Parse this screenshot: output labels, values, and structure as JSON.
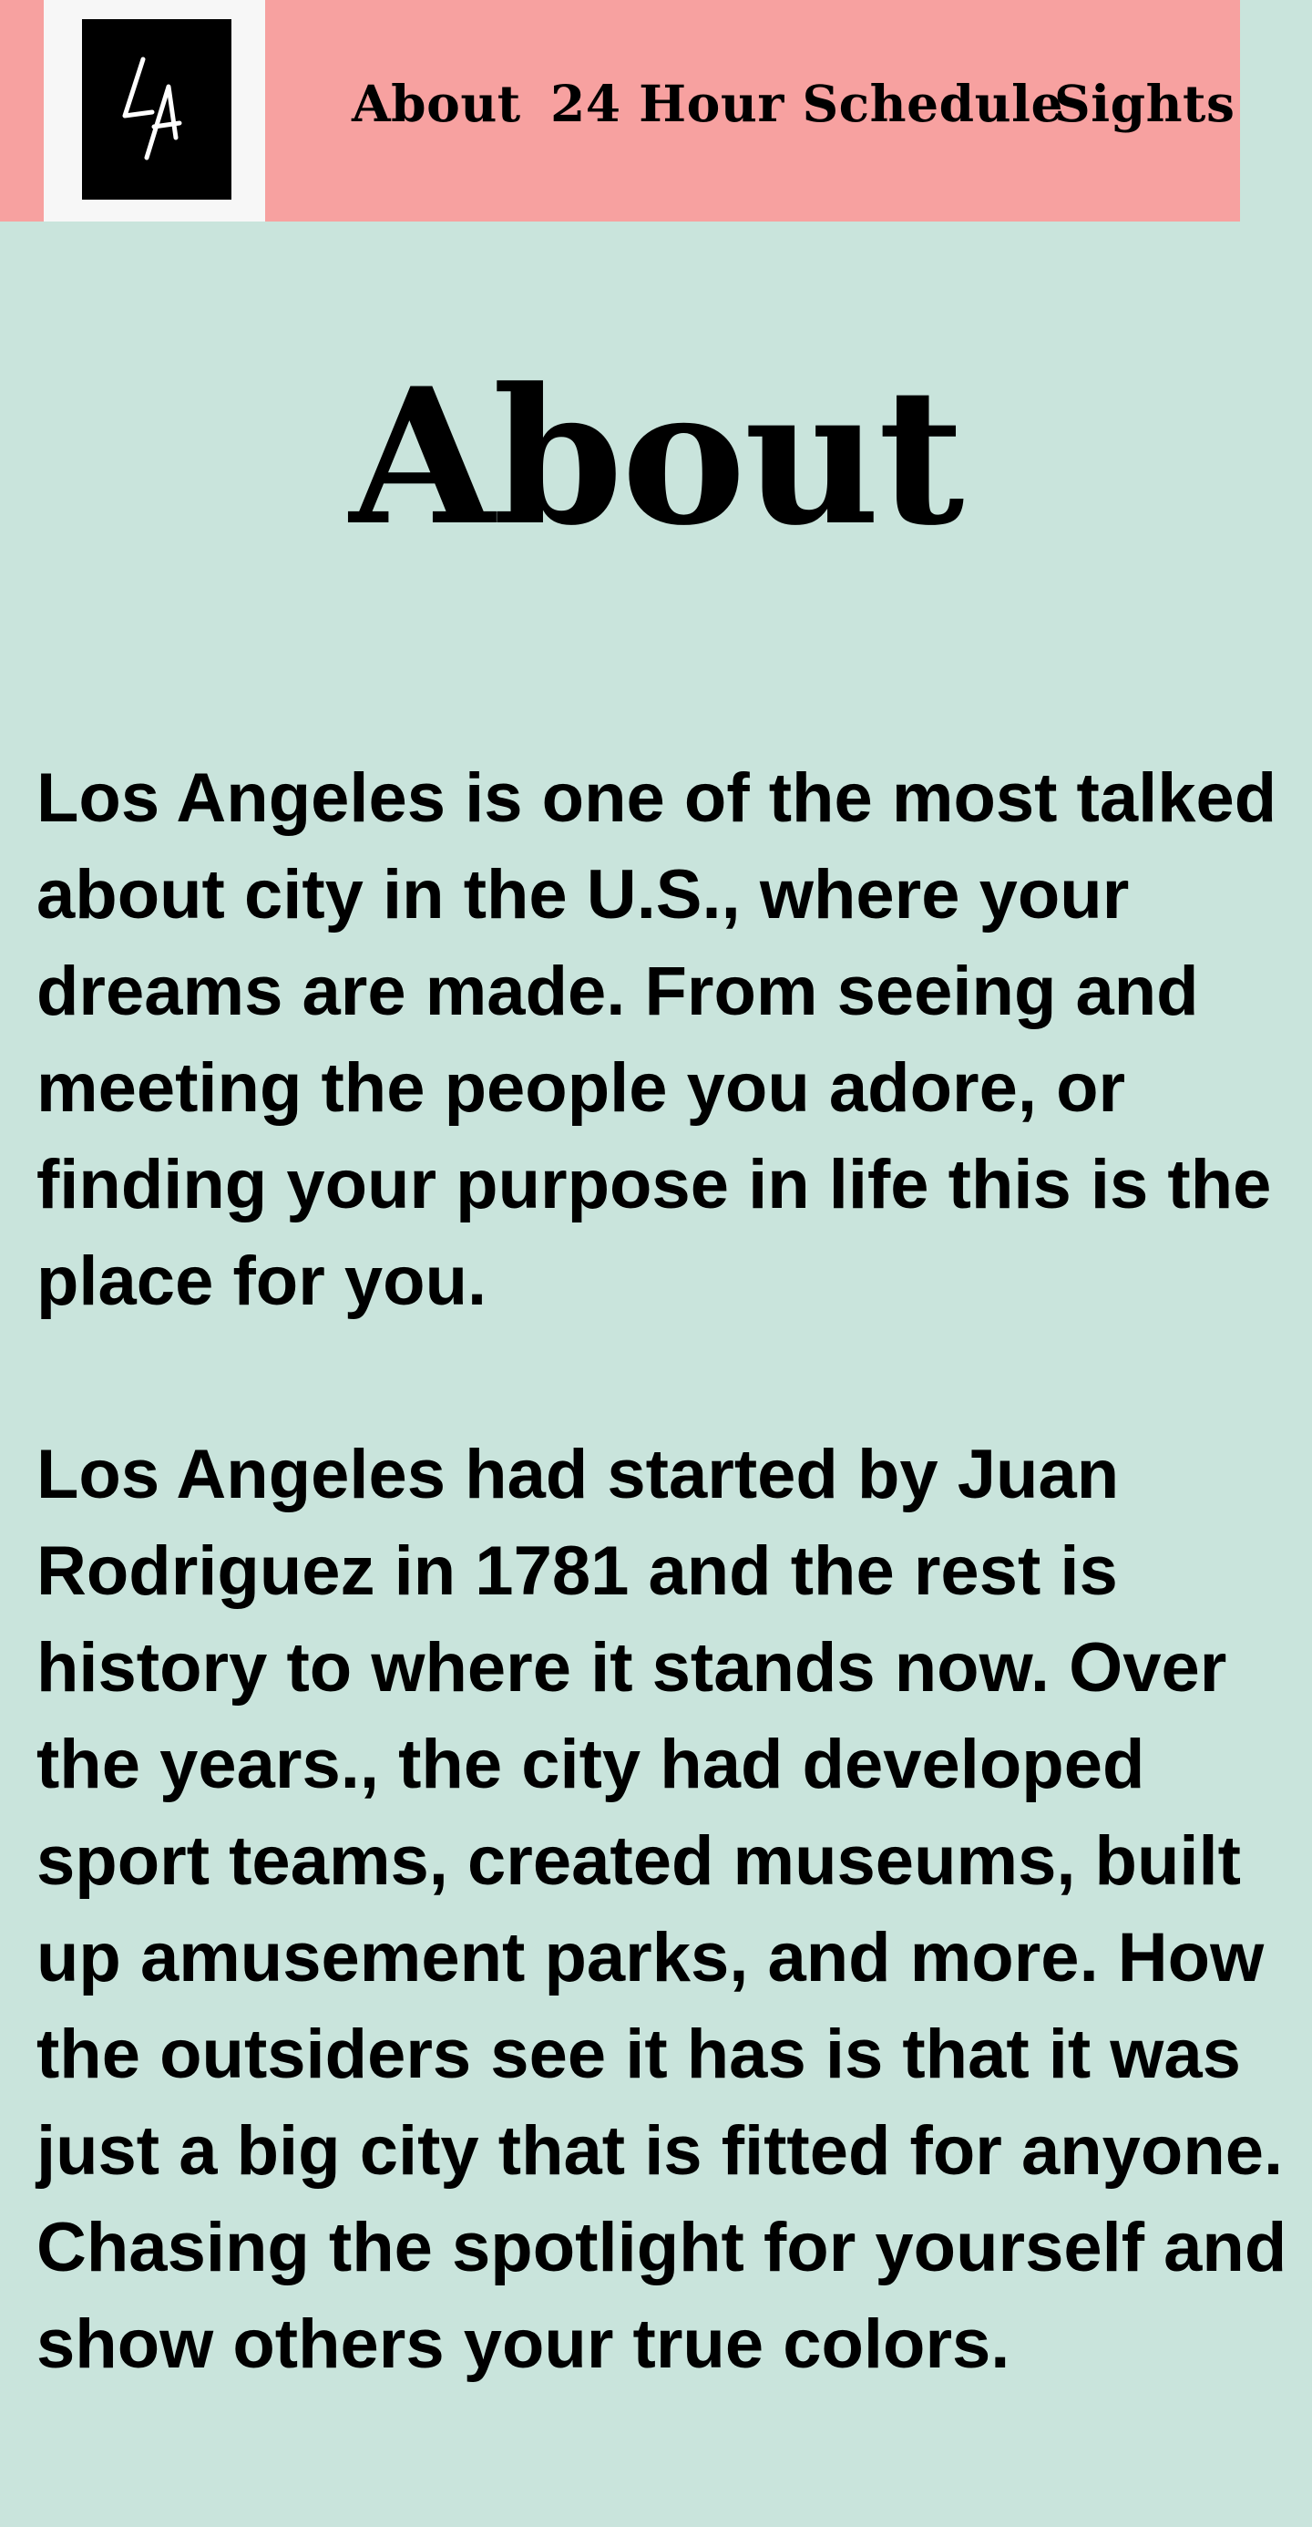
{
  "header": {
    "logo": {
      "text": "LA",
      "icon": "la-logo-icon"
    },
    "nav": [
      {
        "label": "About"
      },
      {
        "label": "24 Hour Schedule"
      },
      {
        "label": "Sights"
      }
    ]
  },
  "main": {
    "title": "About",
    "paragraphs": [
      "Los Angeles is one of the most talked about city in the U.S., where your dreams are made. From seeing and meeting the people you adore, or finding your purpose in life this is the place for you.",
      "Los Angeles had started by Juan Rodriguez in 1781  and the rest is history to where it stands now. Over the years., the city had developed sport teams, created museums, built up amusement parks, and more. How the outsiders see it has is that it was just a big city that is fitted for anyone. Chasing the  spotlight for yourself and show others your true colors."
    ]
  },
  "colors": {
    "page_background": "#c9e4dc",
    "header_background": "#f7a1a0",
    "logo_tile_background": "#f7f7f7",
    "logo_mark_background": "#000000",
    "logo_stroke": "#ffffff",
    "text": "#000000"
  }
}
